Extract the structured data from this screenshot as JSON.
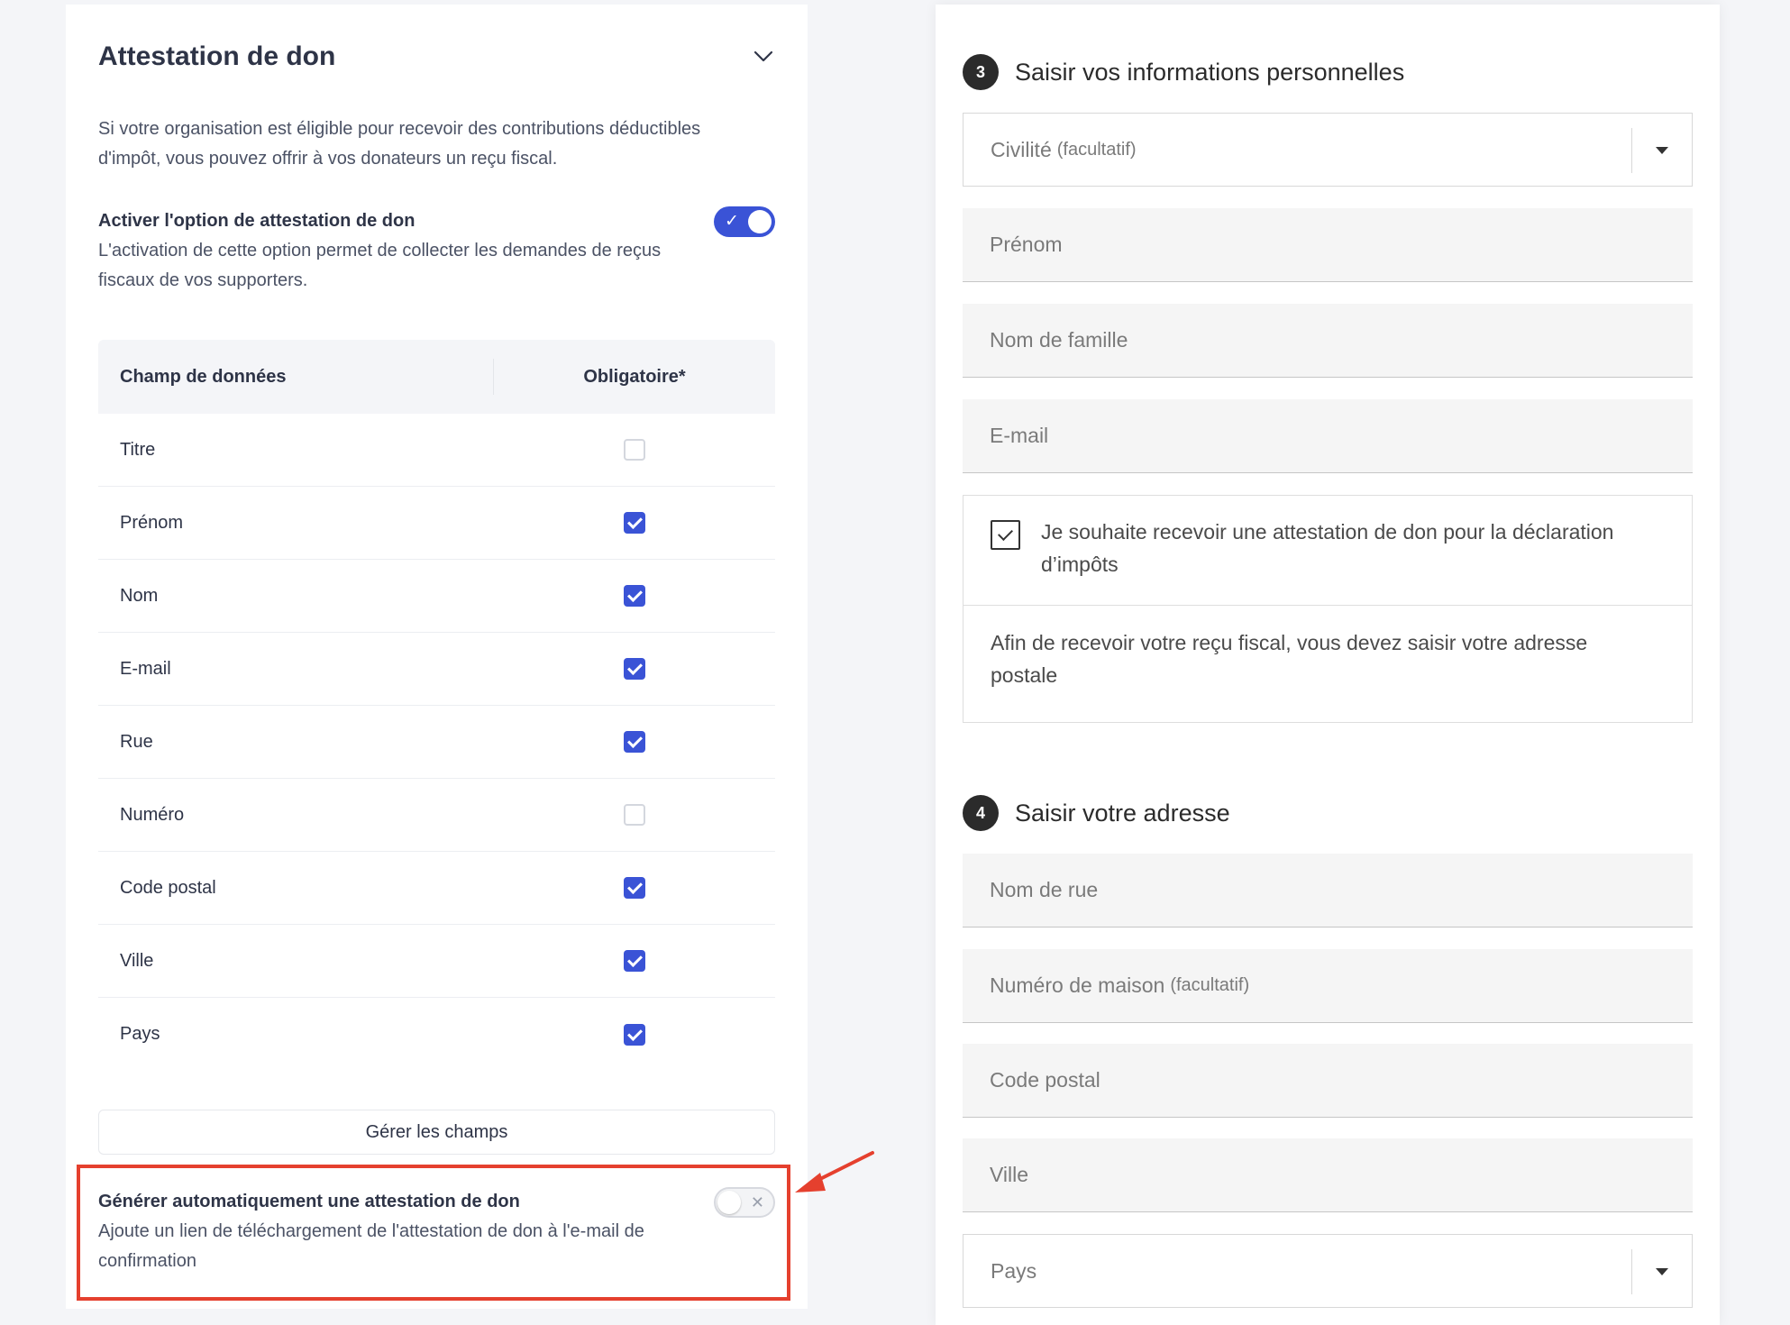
{
  "left_panel": {
    "title": "Attestation de don",
    "intro": "Si votre organisation est éligible pour recevoir des contributions déductibles d'impôt, vous pouvez offrir à vos donateurs un reçu fiscal.",
    "activate": {
      "title": "Activer l'option de attestation de don",
      "description": "L'activation de cette option permet de collecter les demandes de reçus fiscaux de vos supporters.",
      "toggle_on": true
    },
    "table": {
      "col_field": "Champ de données",
      "col_required": "Obligatoire*",
      "rows": [
        {
          "label": "Titre",
          "required": false
        },
        {
          "label": "Prénom",
          "required": true
        },
        {
          "label": "Nom",
          "required": true
        },
        {
          "label": "E-mail",
          "required": true
        },
        {
          "label": "Rue",
          "required": true
        },
        {
          "label": "Numéro",
          "required": false
        },
        {
          "label": "Code postal",
          "required": true
        },
        {
          "label": "Ville",
          "required": true
        },
        {
          "label": "Pays",
          "required": true
        }
      ]
    },
    "manage_button": "Gérer les champs",
    "auto": {
      "title": "Générer automatiquement une attestation de don",
      "description": "Ajoute un lien de téléchargement de l'attestation de don à l'e-mail de confirmation",
      "toggle_on": false
    }
  },
  "right_panel": {
    "step3": {
      "number": "3",
      "title": "Saisir vos informations personnelles",
      "civility": {
        "placeholder": "Civilité",
        "optional": "(facultatif)"
      },
      "first_name": "Prénom",
      "last_name": "Nom de famille",
      "email": "E-mail",
      "consent": "Je souhaite recevoir une attestation de don pour la déclaration d’impôts",
      "consent_checked": true,
      "address_note": "Afin de recevoir votre reçu fiscal, vous devez saisir votre adresse postale"
    },
    "step4": {
      "number": "4",
      "title": "Saisir votre adresse",
      "street": "Nom de rue",
      "house_number": {
        "placeholder": "Numéro de maison",
        "optional": "(facultatif)"
      },
      "postal_code": "Code postal",
      "city": "Ville",
      "country": "Pays"
    }
  },
  "colors": {
    "accent": "#3a53d6",
    "highlight": "#e5402e"
  }
}
